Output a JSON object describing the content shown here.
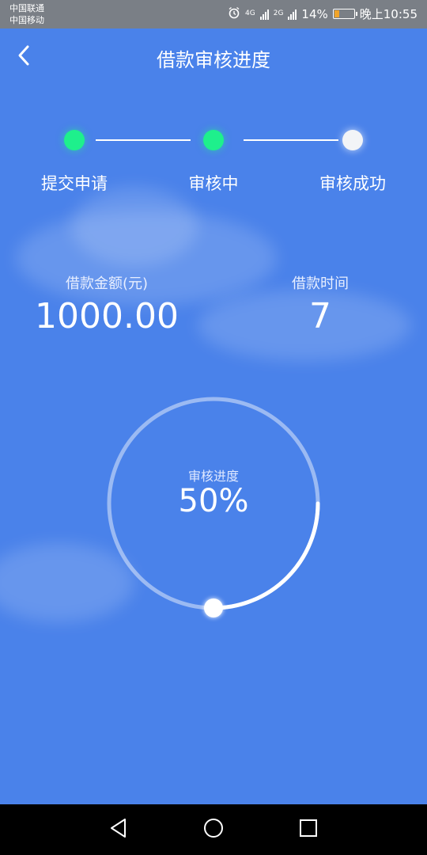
{
  "status_bar": {
    "carrier1": "中国联通",
    "carrier2": "中国移动",
    "network1": "4G",
    "network2": "2G",
    "battery": "14%",
    "time": "晚上10:55",
    "icons": [
      "alarm-icon",
      "signal-icon",
      "battery-icon"
    ]
  },
  "header": {
    "title": "借款审核进度",
    "back_icon": "chevron-left-icon"
  },
  "progress_steps": [
    {
      "label": "提交申请",
      "state": "done",
      "color": "#1ef08c"
    },
    {
      "label": "审核中",
      "state": "done",
      "color": "#1ef08c"
    },
    {
      "label": "审核成功",
      "state": "pending",
      "color": "#f2f4f7"
    }
  ],
  "loan": {
    "amount_label": "借款金额(元)",
    "amount_value": "1000.00",
    "term_label": "借款时间",
    "term_value": "7"
  },
  "gauge": {
    "label": "审核进度",
    "value_text": "50%",
    "progress": 0.5
  },
  "nav_bar": {
    "icons": [
      "back-triangle-icon",
      "home-circle-icon",
      "recents-square-icon"
    ]
  },
  "colors": {
    "background": "#4a82ea",
    "accent_green": "#1ef08c",
    "status_bar": "#7a7f86"
  }
}
